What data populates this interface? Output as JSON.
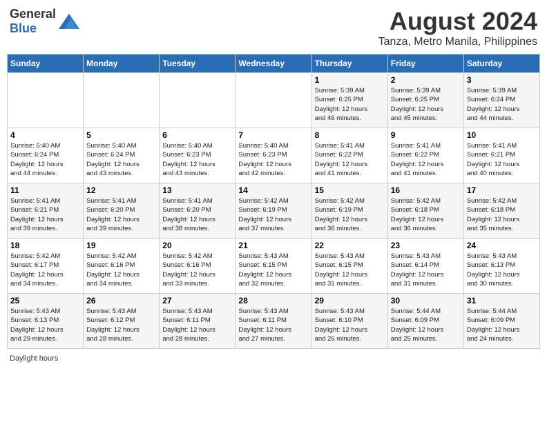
{
  "header": {
    "logo_general": "General",
    "logo_blue": "Blue",
    "month_year": "August 2024",
    "location": "Tanza, Metro Manila, Philippines"
  },
  "days_of_week": [
    "Sunday",
    "Monday",
    "Tuesday",
    "Wednesday",
    "Thursday",
    "Friday",
    "Saturday"
  ],
  "weeks": [
    [
      {
        "day": "",
        "info": ""
      },
      {
        "day": "",
        "info": ""
      },
      {
        "day": "",
        "info": ""
      },
      {
        "day": "",
        "info": ""
      },
      {
        "day": "1",
        "info": "Sunrise: 5:39 AM\nSunset: 6:25 PM\nDaylight: 12 hours\nand 46 minutes."
      },
      {
        "day": "2",
        "info": "Sunrise: 5:39 AM\nSunset: 6:25 PM\nDaylight: 12 hours\nand 45 minutes."
      },
      {
        "day": "3",
        "info": "Sunrise: 5:39 AM\nSunset: 6:24 PM\nDaylight: 12 hours\nand 44 minutes."
      }
    ],
    [
      {
        "day": "4",
        "info": "Sunrise: 5:40 AM\nSunset: 6:24 PM\nDaylight: 12 hours\nand 44 minutes."
      },
      {
        "day": "5",
        "info": "Sunrise: 5:40 AM\nSunset: 6:24 PM\nDaylight: 12 hours\nand 43 minutes."
      },
      {
        "day": "6",
        "info": "Sunrise: 5:40 AM\nSunset: 6:23 PM\nDaylight: 12 hours\nand 43 minutes."
      },
      {
        "day": "7",
        "info": "Sunrise: 5:40 AM\nSunset: 6:23 PM\nDaylight: 12 hours\nand 42 minutes."
      },
      {
        "day": "8",
        "info": "Sunrise: 5:41 AM\nSunset: 6:22 PM\nDaylight: 12 hours\nand 41 minutes."
      },
      {
        "day": "9",
        "info": "Sunrise: 5:41 AM\nSunset: 6:22 PM\nDaylight: 12 hours\nand 41 minutes."
      },
      {
        "day": "10",
        "info": "Sunrise: 5:41 AM\nSunset: 6:21 PM\nDaylight: 12 hours\nand 40 minutes."
      }
    ],
    [
      {
        "day": "11",
        "info": "Sunrise: 5:41 AM\nSunset: 6:21 PM\nDaylight: 12 hours\nand 39 minutes."
      },
      {
        "day": "12",
        "info": "Sunrise: 5:41 AM\nSunset: 6:20 PM\nDaylight: 12 hours\nand 39 minutes."
      },
      {
        "day": "13",
        "info": "Sunrise: 5:41 AM\nSunset: 6:20 PM\nDaylight: 12 hours\nand 38 minutes."
      },
      {
        "day": "14",
        "info": "Sunrise: 5:42 AM\nSunset: 6:19 PM\nDaylight: 12 hours\nand 37 minutes."
      },
      {
        "day": "15",
        "info": "Sunrise: 5:42 AM\nSunset: 6:19 PM\nDaylight: 12 hours\nand 36 minutes."
      },
      {
        "day": "16",
        "info": "Sunrise: 5:42 AM\nSunset: 6:18 PM\nDaylight: 12 hours\nand 36 minutes."
      },
      {
        "day": "17",
        "info": "Sunrise: 5:42 AM\nSunset: 6:18 PM\nDaylight: 12 hours\nand 35 minutes."
      }
    ],
    [
      {
        "day": "18",
        "info": "Sunrise: 5:42 AM\nSunset: 6:17 PM\nDaylight: 12 hours\nand 34 minutes."
      },
      {
        "day": "19",
        "info": "Sunrise: 5:42 AM\nSunset: 6:16 PM\nDaylight: 12 hours\nand 34 minutes."
      },
      {
        "day": "20",
        "info": "Sunrise: 5:42 AM\nSunset: 6:16 PM\nDaylight: 12 hours\nand 33 minutes."
      },
      {
        "day": "21",
        "info": "Sunrise: 5:43 AM\nSunset: 6:15 PM\nDaylight: 12 hours\nand 32 minutes."
      },
      {
        "day": "22",
        "info": "Sunrise: 5:43 AM\nSunset: 6:15 PM\nDaylight: 12 hours\nand 31 minutes."
      },
      {
        "day": "23",
        "info": "Sunrise: 5:43 AM\nSunset: 6:14 PM\nDaylight: 12 hours\nand 31 minutes."
      },
      {
        "day": "24",
        "info": "Sunrise: 5:43 AM\nSunset: 6:13 PM\nDaylight: 12 hours\nand 30 minutes."
      }
    ],
    [
      {
        "day": "25",
        "info": "Sunrise: 5:43 AM\nSunset: 6:13 PM\nDaylight: 12 hours\nand 29 minutes."
      },
      {
        "day": "26",
        "info": "Sunrise: 5:43 AM\nSunset: 6:12 PM\nDaylight: 12 hours\nand 28 minutes."
      },
      {
        "day": "27",
        "info": "Sunrise: 5:43 AM\nSunset: 6:11 PM\nDaylight: 12 hours\nand 28 minutes."
      },
      {
        "day": "28",
        "info": "Sunrise: 5:43 AM\nSunset: 6:11 PM\nDaylight: 12 hours\nand 27 minutes."
      },
      {
        "day": "29",
        "info": "Sunrise: 5:43 AM\nSunset: 6:10 PM\nDaylight: 12 hours\nand 26 minutes."
      },
      {
        "day": "30",
        "info": "Sunrise: 5:44 AM\nSunset: 6:09 PM\nDaylight: 12 hours\nand 25 minutes."
      },
      {
        "day": "31",
        "info": "Sunrise: 5:44 AM\nSunset: 6:09 PM\nDaylight: 12 hours\nand 24 minutes."
      }
    ]
  ],
  "footer": {
    "daylight_label": "Daylight hours"
  }
}
